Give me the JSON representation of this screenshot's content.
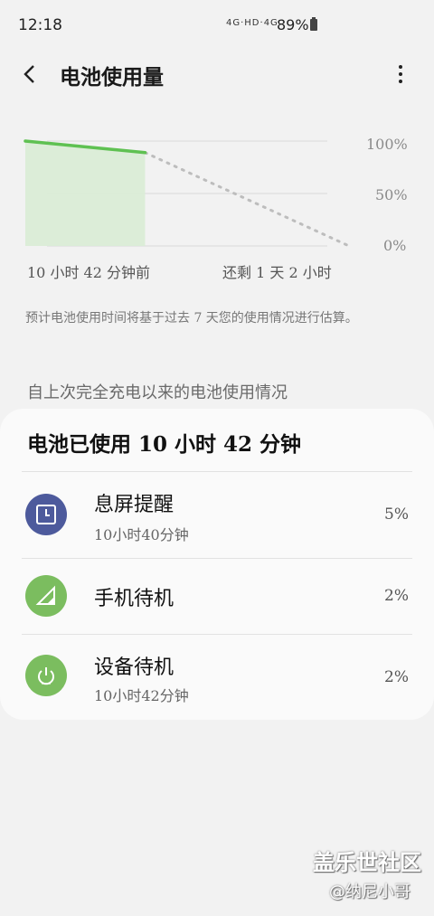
{
  "status": {
    "time": "12:18",
    "network": "4G·HD·4G",
    "battery": "89%"
  },
  "header": {
    "back_icon": "back-arrow-icon",
    "title": "电池使用量",
    "more_icon": "more-vert-icon"
  },
  "chart_data": {
    "type": "line",
    "y_ticks": [
      "100%",
      "50%",
      "0%"
    ],
    "ylim": [
      0,
      100
    ],
    "x_start_label": "10 小时 42 分钟前",
    "x_end_label": "还剩 1 天 2 小时",
    "actual": [
      [
        0,
        100
      ],
      [
        0.37,
        89
      ]
    ],
    "projected": [
      [
        0.37,
        89
      ],
      [
        1.0,
        0
      ]
    ],
    "colors": {
      "actual": "#5fc152",
      "fill": "#d8ecd3",
      "projected": "#bdbdbd",
      "grid": "#e0e0e0"
    }
  },
  "note": "预计电池使用时间将基于过去 7 天您的使用情况进行估算。",
  "section_title": "自上次完全充电以来的电池使用情况",
  "card": {
    "header": "电池已使用 10 小时 42 分钟",
    "rows": [
      {
        "name": "息屏提醒",
        "sub": "10小时40分钟",
        "percent": "5%",
        "icon": "clock-screen-icon",
        "icon_color": "#4d5a9c"
      },
      {
        "name": "手机待机",
        "sub": "",
        "percent": "2%",
        "icon": "signal-icon",
        "icon_color": "#7bbd5f"
      },
      {
        "name": "设备待机",
        "sub": "10小时42分钟",
        "percent": "2%",
        "icon": "power-icon",
        "icon_color": "#7bbd5f"
      }
    ]
  },
  "watermark": {
    "line1": "盖乐世社区",
    "line2": "@纳尼小哥"
  }
}
